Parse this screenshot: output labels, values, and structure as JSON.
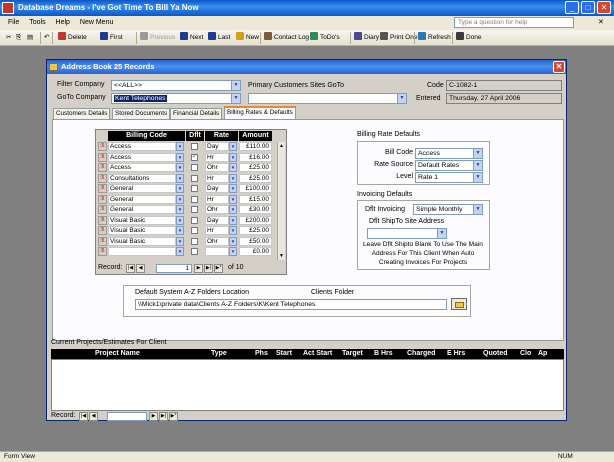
{
  "app": {
    "title": "Database Dreams - I've Got Time To Bill Ya Now",
    "help_placeholder": "Type a question for help",
    "status_left": "Form View",
    "status_right": "NUM"
  },
  "menu": [
    "File",
    "Tools",
    "Help",
    "New Menu"
  ],
  "toolbar": [
    {
      "label": "Delete",
      "icon": "delete-icon",
      "color": "#c0392b",
      "enabled": true
    },
    {
      "label": "First",
      "icon": "first-record-icon",
      "color": "#1f3a93",
      "enabled": true
    },
    {
      "label": "Previous",
      "icon": "previous-record-icon",
      "color": "#9a9a9a",
      "enabled": false
    },
    {
      "label": "Next",
      "icon": "next-record-icon",
      "color": "#1f3a93",
      "enabled": true
    },
    {
      "label": "Last",
      "icon": "last-record-icon",
      "color": "#1f3a93",
      "enabled": true
    },
    {
      "label": "New",
      "icon": "new-record-icon",
      "color": "#d4a017",
      "enabled": true
    },
    {
      "label": "Contact Log",
      "icon": "contact-log-icon",
      "color": "#7b5b3a",
      "enabled": true
    },
    {
      "label": "ToDo's",
      "icon": "todo-icon",
      "color": "#2e8b57",
      "enabled": true
    },
    {
      "label": "Diary",
      "icon": "diary-icon",
      "color": "#4a4a8a",
      "enabled": true
    },
    {
      "label": "Print One",
      "icon": "print-icon",
      "color": "#555555",
      "enabled": true
    },
    {
      "label": "Refresh",
      "icon": "refresh-icon",
      "color": "#2a7ab0",
      "enabled": true
    },
    {
      "label": "Done",
      "icon": "done-icon",
      "color": "#3a3a3a",
      "enabled": true
    }
  ],
  "dialog": {
    "title": "Address Book 25 Records",
    "filter_company_label": "Filter Company",
    "filter_company_value": "<<ALL>>",
    "goto_company_label": "GoTo Company",
    "goto_company_value": "Kent Telephones",
    "primary_sites_label": "Primary Customers Sites GoTo",
    "primary_sites_value": "",
    "code_label": "Code",
    "code_value": "C-1082-1",
    "entered_label": "Entered",
    "entered_value": "Thursday, 27 April 2006"
  },
  "tabs": [
    "Customers Details",
    "Stored Documents",
    "Financial Details",
    "Billing Rates & Defaults"
  ],
  "billing_grid": {
    "headers": [
      "Billing Code",
      "Dflt",
      "Rate",
      "Amount"
    ],
    "rows": [
      {
        "code": "Access",
        "dflt": false,
        "rate": "Day",
        "amount": "£110.00"
      },
      {
        "code": "Access",
        "dflt": true,
        "rate": "Hr",
        "amount": "£16.00"
      },
      {
        "code": "Access",
        "dflt": false,
        "rate": "Ohr",
        "amount": "£25.00"
      },
      {
        "code": "Consultations",
        "dflt": false,
        "rate": "Hr",
        "amount": "£25.00"
      },
      {
        "code": "General",
        "dflt": false,
        "rate": "Day",
        "amount": "£100.00"
      },
      {
        "code": "General",
        "dflt": false,
        "rate": "Hr",
        "amount": "£15.00"
      },
      {
        "code": "General",
        "dflt": false,
        "rate": "Ohr",
        "amount": "£30.00"
      },
      {
        "code": "Visual Basic",
        "dflt": false,
        "rate": "Day",
        "amount": "£200.00"
      },
      {
        "code": "Visual Basic",
        "dflt": false,
        "rate": "Hr",
        "amount": "£25.00"
      },
      {
        "code": "Visual Basic",
        "dflt": false,
        "rate": "Ohr",
        "amount": "£50.00"
      },
      {
        "code": "",
        "dflt": false,
        "rate": "",
        "amount": "£0.00"
      }
    ],
    "nav_label": "Record:",
    "nav_current": "1",
    "nav_total": "of 10"
  },
  "billing_defaults": {
    "heading": "Billing Rate Defaults",
    "bill_code_label": "Bill Code",
    "bill_code_value": "Access",
    "rate_source_label": "Rate Source",
    "rate_source_value": "Default Rates",
    "level_label": "Level",
    "level_value": "Rate 1"
  },
  "invoicing": {
    "heading": "Invoicing Defaults",
    "dflt_invoicing_label": "Dflt Invoicing",
    "dflt_invoicing_value": "Simple Monthly",
    "shipto_label": "Dflt ShipTo Site Address",
    "shipto_value": "",
    "hint": "Leave Dflt Shipto Blank To Use The Main Address For This Client When Auto Creating Invoices For Projects"
  },
  "folders": {
    "default_label": "Default System A-Z Folders Location",
    "clients_label": "Clients Folder",
    "path": "\\\\Mick1\\private data\\Clients A-Z Folders\\K\\Kent Telephones"
  },
  "projects": {
    "heading": "Current Projects/Estimates For Client",
    "columns": [
      "Project Name",
      "Type",
      "Phs",
      "Start",
      "Act Start",
      "Target",
      "B Hrs",
      "Charged",
      "E Hrs",
      "Quoted",
      "Clo",
      "Ap"
    ],
    "nav_label": "Record:"
  }
}
